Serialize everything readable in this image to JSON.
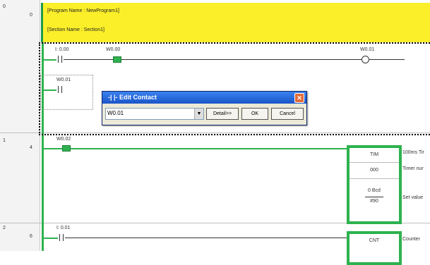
{
  "rungs": [
    {
      "rung": "0",
      "step": "0"
    },
    {
      "rung": "1",
      "step": "4"
    },
    {
      "rung": "2",
      "step": "6"
    }
  ],
  "banner": {
    "program": "[Program Name : NewProgram1]",
    "section": "[Section Name : Section1]"
  },
  "rung0": {
    "contact1": "I: 0.00",
    "contact2": "W0.00",
    "coil": "W0.01",
    "branch_contact": "W0.01"
  },
  "dialog": {
    "title": "-|  |- Edit Contact",
    "operand": "W0.01",
    "detail_label": "Detail>>",
    "ok_label": "OK",
    "cancel_label": "Cancel"
  },
  "rung1": {
    "contact": "W0.02",
    "instruction": "TIM",
    "timer_number": "000",
    "set_value_top": "0 Bcd",
    "set_value": "#90",
    "comment_instruction": "100ms Tir",
    "comment_number": "Timer nur",
    "comment_set_value": "Set value"
  },
  "rung2": {
    "contact": "I: 0.01",
    "instruction": "CNT",
    "comment_instruction": "Counter"
  }
}
